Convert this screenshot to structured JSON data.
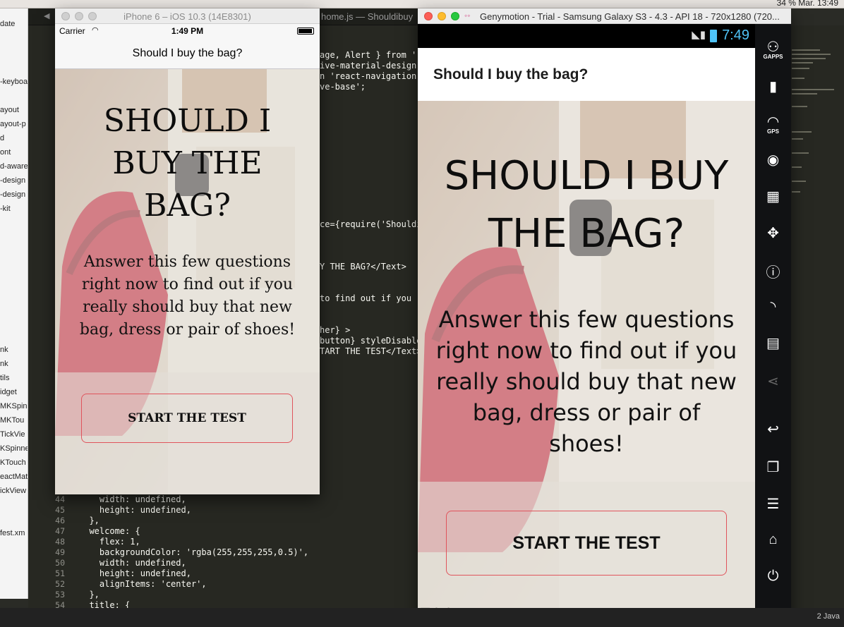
{
  "mac_menu": {
    "right_text": "34 %  Mar. 13:49"
  },
  "sidebar": {
    "items": [
      "date",
      "-keyboa",
      "ayout",
      "ayout-p",
      "d",
      "ont",
      "d-aware",
      "-design",
      "-design",
      "-kit",
      "nk",
      "nk",
      "tils",
      "idget",
      "MKSpin",
      "MKTou",
      "TickVie",
      "KSpinne",
      "KTouch",
      "eactMat",
      "ickView",
      "fest.xm"
    ]
  },
  "editor": {
    "tab_title": "home.js — Shouldibuy",
    "top_code": [
      "age, Alert } from 're",
      "ive-material-design';",
      "n 'react-navigation';",
      "ve-base';"
    ],
    "mid_code": [
      "ce={require('Shouldi",
      "Y THE BAG?</Text>",
      "to find out if you re",
      "her} >",
      "button} styleDisabled",
      "TART THE TEST</Text>"
    ],
    "line_numbers": [
      "44",
      "45",
      "46",
      "47",
      "48",
      "49",
      "50",
      "51",
      "52",
      "53",
      "54"
    ],
    "bottom_code": [
      "    width: undefined,",
      "    height: undefined,",
      "  },",
      "  welcome: {",
      "    flex: 1,",
      "    backgroundColor: 'rgba(255,255,255,0.5)',",
      "    width: undefined,",
      "    height: undefined,",
      "    alignItems: 'center',",
      "  },",
      "  title: {"
    ]
  },
  "ios": {
    "window_title": "iPhone 6 – iOS 10.3 (14E8301)",
    "carrier": "Carrier",
    "time": "1:49 PM",
    "nav_title": "Should I buy the bag?",
    "headline": "SHOULD I BUY THE BAG?",
    "body": "Answer this few questions right now to find out if you really should buy that new bag, dress or pair of shoes!",
    "button_label": "START THE TEST"
  },
  "android": {
    "window_title": "Genymotion - Trial - Samsung Galaxy S3 - 4.3 - API 18 - 720x1280 (720...",
    "time": "7:49",
    "appbar_title": "Should I buy the bag?",
    "headline": "SHOULD I BUY THE BAG?",
    "body": "Answer this few questions right now to find out if you really should buy that new bag, dress or pair of shoes!",
    "button_label": "START THE TEST",
    "watermark": "Trial",
    "side_buttons": [
      {
        "icon": "gapps-icon",
        "label": "GAPPS"
      },
      {
        "icon": "battery-icon",
        "label": ""
      },
      {
        "icon": "gps-icon",
        "label": "GPS"
      },
      {
        "icon": "camera-icon",
        "label": ""
      },
      {
        "icon": "video-icon",
        "label": ""
      },
      {
        "icon": "dpad-icon",
        "label": ""
      },
      {
        "icon": "id-icon",
        "label": ""
      },
      {
        "icon": "rss-icon",
        "label": ""
      },
      {
        "icon": "sms-icon",
        "label": ""
      },
      {
        "icon": "share-icon",
        "label": ""
      },
      {
        "icon": "back-icon",
        "label": ""
      },
      {
        "icon": "recent-apps-icon",
        "label": ""
      },
      {
        "icon": "menu-icon",
        "label": ""
      },
      {
        "icon": "home-icon",
        "label": ""
      },
      {
        "icon": "power-icon",
        "label": ""
      },
      {
        "icon": "more-icon",
        "label": ""
      }
    ]
  },
  "status_bar": {
    "right_text": "2     Java"
  },
  "colors": {
    "button_border": "#e0545c",
    "android_time": "#4fc3f7",
    "editor_bg": "#272822"
  }
}
